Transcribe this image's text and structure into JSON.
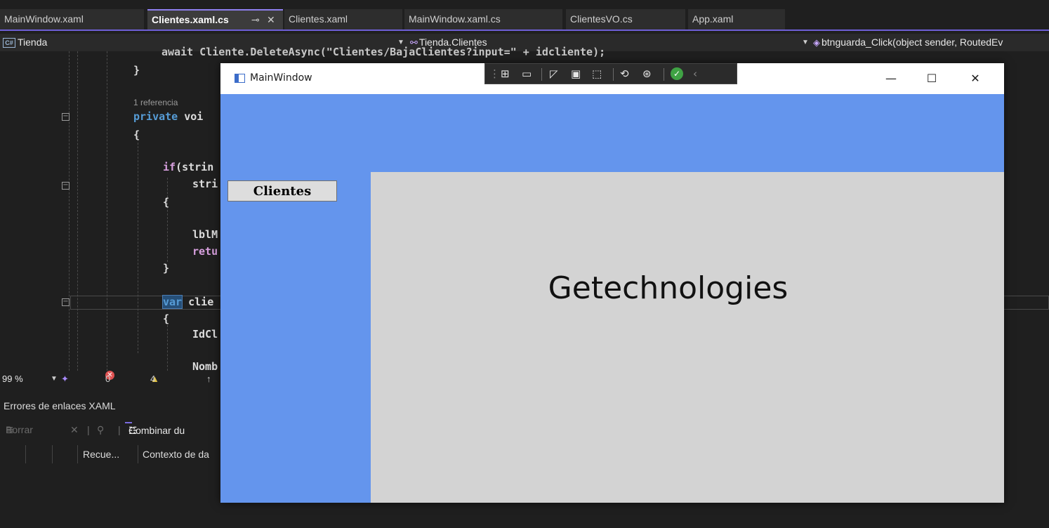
{
  "tabs": [
    {
      "label": "MainWindow.xaml",
      "active": false
    },
    {
      "label": "Clientes.xaml.cs",
      "active": true,
      "pin_icon": "pin-icon",
      "close_icon": "close-icon"
    },
    {
      "label": "Clientes.xaml",
      "active": false
    },
    {
      "label": "MainWindow.xaml.cs",
      "active": false
    },
    {
      "label": "ClientesVO.cs",
      "active": false
    },
    {
      "label": "App.xaml",
      "active": false
    }
  ],
  "navbar": {
    "project_badge": "C#",
    "project": "Tienda",
    "class_name": "Tienda.Clientes",
    "member": "btnguarda_Click(object sender, RoutedEv"
  },
  "code": {
    "line0": "await Cliente.DeleteAsync(\"Clientes/BajaClientes?input=\" + idcliente);",
    "line1": "}",
    "references": "1 referencia",
    "line2_kw": "private",
    "line2_rest": " voi",
    "line3": "{",
    "line4_kw": "if",
    "line4_rest": "(strin",
    "line5": "stri",
    "line6": "{",
    "line7": "lblM",
    "line8": "retu",
    "line9": "}",
    "line10_kw": "var",
    "line10_rest": " clie",
    "line11": "{",
    "line12": "IdCl",
    "line13": "Nomb"
  },
  "status": {
    "zoom": "99 %",
    "errors": "0",
    "warnings": "4"
  },
  "panel": {
    "title": "Errores de enlaces XAML",
    "clear_label": "Borrar",
    "combine_label": "Combinar du",
    "col_count": "Recue...",
    "col_context": "Contexto de da"
  },
  "wpf_window": {
    "title": "MainWindow",
    "minimize": "—",
    "maximize": "☐",
    "close": "✕",
    "clientes_button": "Clientes",
    "brand_text": "Getechnologies"
  },
  "colors": {
    "window_background": "#6495ed",
    "content_background": "#d3d3d3",
    "active_tab_accent": "#8f7ff0"
  }
}
